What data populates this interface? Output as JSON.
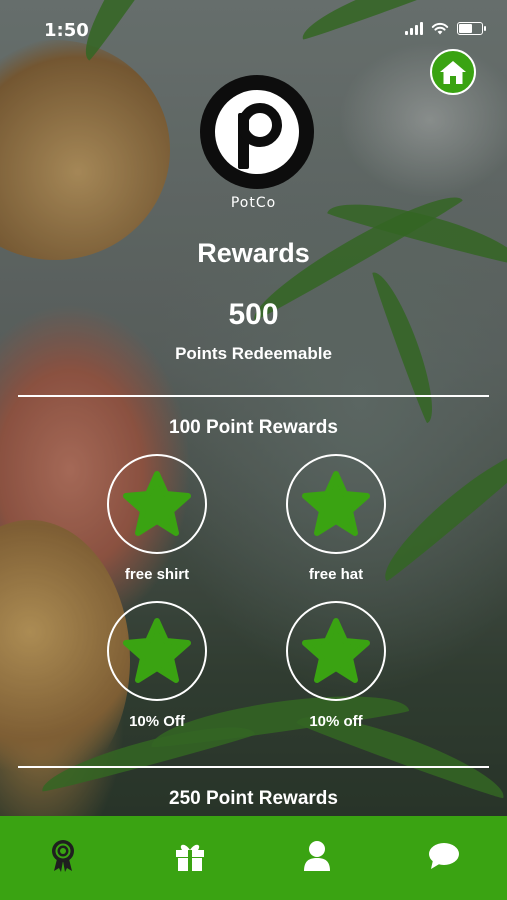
{
  "status_bar": {
    "time": "1:50"
  },
  "brand": {
    "name": "PotCo",
    "accent_color": "#3aa312"
  },
  "header": {
    "title": "Rewards",
    "points_value": "500",
    "points_label": "Points Redeemable"
  },
  "sections": [
    {
      "title": "100 Point Rewards",
      "rewards": [
        {
          "label": "free shirt",
          "icon": "star-icon"
        },
        {
          "label": "free hat",
          "icon": "star-icon"
        },
        {
          "label": "10% Off",
          "icon": "star-icon"
        },
        {
          "label": "10% off",
          "icon": "star-icon"
        }
      ]
    },
    {
      "title": "250 Point Rewards",
      "rewards": []
    }
  ],
  "tabbar": {
    "active_tab": "rewards",
    "tabs": [
      {
        "id": "rewards",
        "icon": "award-ribbon-icon"
      },
      {
        "id": "gifts",
        "icon": "gift-icon"
      },
      {
        "id": "profile",
        "icon": "user-icon"
      },
      {
        "id": "chat",
        "icon": "chat-bubble-icon"
      }
    ]
  }
}
